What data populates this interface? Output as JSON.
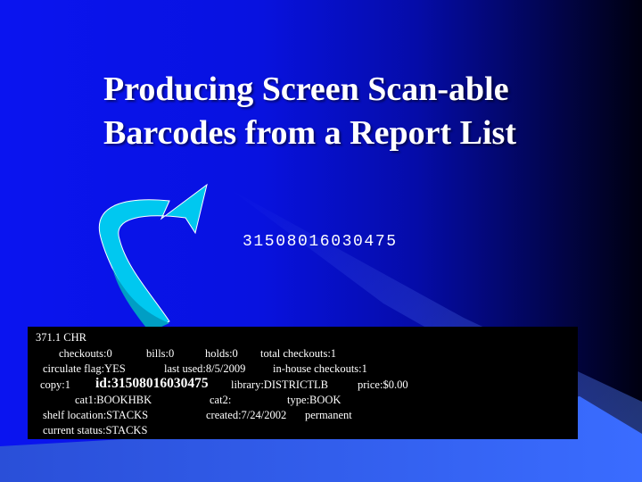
{
  "slide": {
    "title_lines": [
      "Producing Screen Scan-able",
      "Barcodes from a Report List"
    ],
    "barcode_text": "31508016030475",
    "arrow_icon": "curved-arrow-icon",
    "colors": {
      "background_left": "#0a14f0",
      "background_right": "#000010",
      "arrow": "#00c8f0",
      "report_bg": "#000000",
      "text": "#ffffff",
      "accent_band": "#3a66ff"
    }
  },
  "report": {
    "call_number": "371.1 CHR",
    "checkouts": "checkouts:0",
    "bills": "bills:0",
    "holds": "holds:0",
    "total_checkouts": "total checkouts:1",
    "circulate_flag": "circulate flag:YES",
    "last_used": "last used:8/5/2009",
    "in_house_checkouts": "in-house checkouts:1",
    "copy": "copy:1",
    "id": "id:31508016030475",
    "library": "library:DISTRICTLB",
    "price": "price:$0.00",
    "cat1": "cat1:BOOKHBK",
    "cat2": "cat2:",
    "type": "type:BOOK",
    "shelf_location": "shelf location:STACKS",
    "created": "created:7/24/2002",
    "permanent": "permanent",
    "current_status": "current status:STACKS"
  }
}
